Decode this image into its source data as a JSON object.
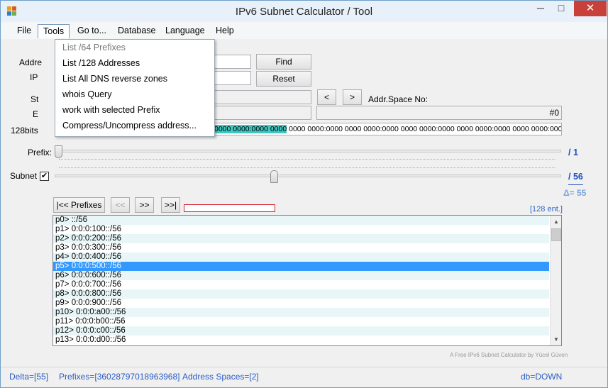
{
  "window": {
    "title": "IPv6 Subnet Calculator / Tool",
    "minimize": "─",
    "maximize": "□",
    "close": "✕"
  },
  "menu": [
    {
      "label": "File"
    },
    {
      "label": "Tools"
    },
    {
      "label": "Go to..."
    },
    {
      "label": "Database"
    },
    {
      "label": "Language"
    },
    {
      "label": "Help"
    }
  ],
  "tools_menu": [
    {
      "label": "List /64 Prefixes",
      "enabled": false
    },
    {
      "label": "List /128 Addresses",
      "enabled": true
    },
    {
      "label": "List All DNS reverse zones",
      "enabled": true
    },
    {
      "label": "whois Query",
      "enabled": true
    },
    {
      "label": "work with selected Prefix",
      "enabled": true
    },
    {
      "label": "Compress/Uncompress address...",
      "enabled": true
    }
  ],
  "form": {
    "address_label": "Addre",
    "ip_label": "IP",
    "start_label": "St",
    "end_label": "E",
    "bits_label": "128bits",
    "find_button": "Find",
    "reset_button": "Reset",
    "prev_button": "<",
    "next_button": ">",
    "addr_space_label": "Addr.Space No:",
    "addr_space_value": "#0",
    "bits_highlight": "0000 0000:0000 0000",
    "bits_rest": " 0000 0000:0000 0000 0000:0000 0000 0000:0000 0000 0000:0000 0000 0000:0000 0000 0000"
  },
  "prefix_slider": {
    "label": "Prefix:",
    "value_text": "/ 1",
    "level": 1,
    "min": 1,
    "max": 128
  },
  "subnet_slider": {
    "label": "Subnet",
    "checked": "✔",
    "value_text": "/ 56",
    "delta_text": "Δ= 55",
    "level": 56,
    "min": 1,
    "max": 128
  },
  "nav": {
    "first_button": "|<< Prefixes",
    "prev_button": "<<",
    "next_button": ">>",
    "last_button": ">>|",
    "count": "[128 ent.]"
  },
  "list": {
    "items": [
      "p0> ::/56",
      "p1> 0:0:0:100::/56",
      "p2> 0:0:0:200::/56",
      "p3> 0:0:0:300::/56",
      "p4> 0:0:0:400::/56",
      "p5> 0:0:0:500::/56",
      "p6> 0:0:0:600::/56",
      "p7> 0:0:0:700::/56",
      "p8> 0:0:0:800::/56",
      "p9> 0:0:0:900::/56",
      "p10> 0:0:0:a00::/56",
      "p11> 0:0:0:b00::/56",
      "p12> 0:0:0:c00::/56",
      "p13> 0:0:0:d00::/56"
    ],
    "selected_index": 5
  },
  "credit": "A Free IPv6 Subnet Calculator  by Yücel Güven",
  "status": {
    "delta": "Delta=[55]",
    "prefixes": "Prefixes=[36028797018963968]",
    "address_spaces": "Address Spaces=[2]",
    "db": "db=DOWN"
  },
  "colors": {
    "accent": "#1f4fbf",
    "selection": "#3399ff",
    "highlight": "#3fc7c0",
    "close_button": "#c7403a"
  },
  "icons": {
    "app": "app-icon",
    "checkbox": "checkmark-icon"
  }
}
